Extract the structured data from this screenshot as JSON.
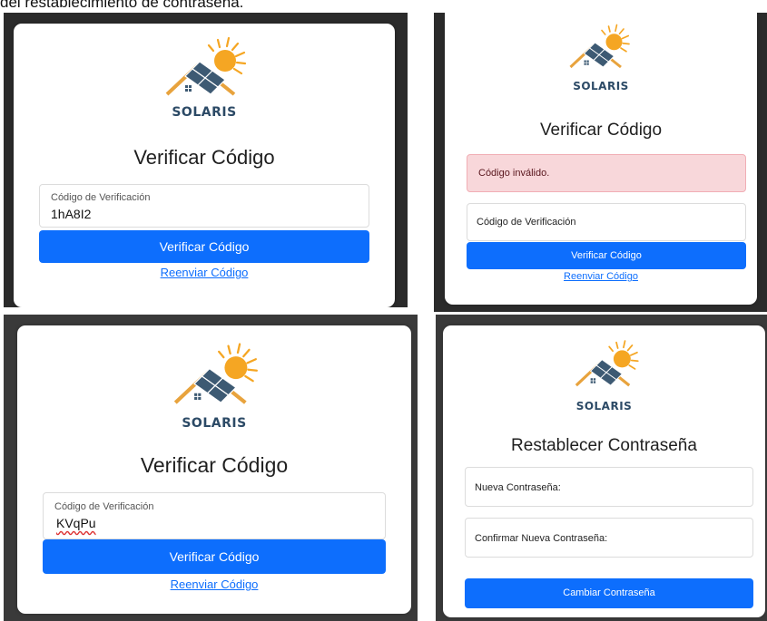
{
  "caption": "del restablecimiento de contraseña.",
  "brand": "SOLARIS",
  "colors": {
    "primary": "#0d6efd",
    "brand_text": "#2c4a66",
    "sun": "#f5a623",
    "roof": "#e8a33d",
    "panel": "#3d5a73",
    "alert_bg": "#f8d7da"
  },
  "panels": {
    "p1": {
      "title": "Verificar Código",
      "field_label": "Código de Verificación",
      "field_value": "1hA8I2",
      "button": "Verificar Código",
      "link": "Reenviar Código"
    },
    "p2": {
      "title": "Verificar Código",
      "alert": "Código inválido.",
      "field_placeholder": "Código de Verificación",
      "button": "Verificar Código",
      "link": "Reenviar Código"
    },
    "p3": {
      "title": "Verificar Código",
      "field_label": "Código de Verificación",
      "field_value": "KVqPu",
      "button": "Verificar Código",
      "link": "Reenviar Código"
    },
    "p4": {
      "title": "Restablecer Contraseña",
      "field1_placeholder": "Nueva Contraseña:",
      "field2_placeholder": "Confirmar Nueva Contraseña:",
      "button": "Cambiar Contraseña"
    }
  }
}
